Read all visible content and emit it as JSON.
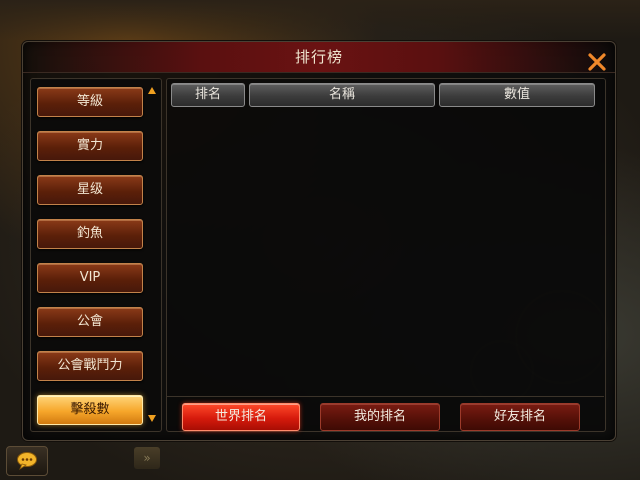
{
  "window": {
    "title": "排行榜"
  },
  "sidebar": {
    "items": [
      {
        "label": "等級",
        "active": false
      },
      {
        "label": "實力",
        "active": false
      },
      {
        "label": "星级",
        "active": false
      },
      {
        "label": "釣魚",
        "active": false
      },
      {
        "label": "VIP",
        "active": false
      },
      {
        "label": "公會",
        "active": false
      },
      {
        "label": "公會戰鬥力",
        "active": false
      },
      {
        "label": "擊殺數",
        "active": true
      }
    ],
    "scroll_up_icon": "triangle-up",
    "scroll_down_icon": "triangle-down"
  },
  "table": {
    "columns": [
      "排名",
      "名稱",
      "數值"
    ],
    "rows": []
  },
  "tabs": [
    {
      "label": "世界排名",
      "active": true
    },
    {
      "label": "我的排名",
      "active": false
    },
    {
      "label": "好友排名",
      "active": false
    }
  ],
  "colors": {
    "close_icon": "#f0882a",
    "active_sidebar": "#f6a62a",
    "active_tab": "#d61a0c",
    "scroll_arrow": "#f0a020"
  },
  "icons": {
    "close": "close-x-icon",
    "chat": "chat-bubble-icon"
  }
}
